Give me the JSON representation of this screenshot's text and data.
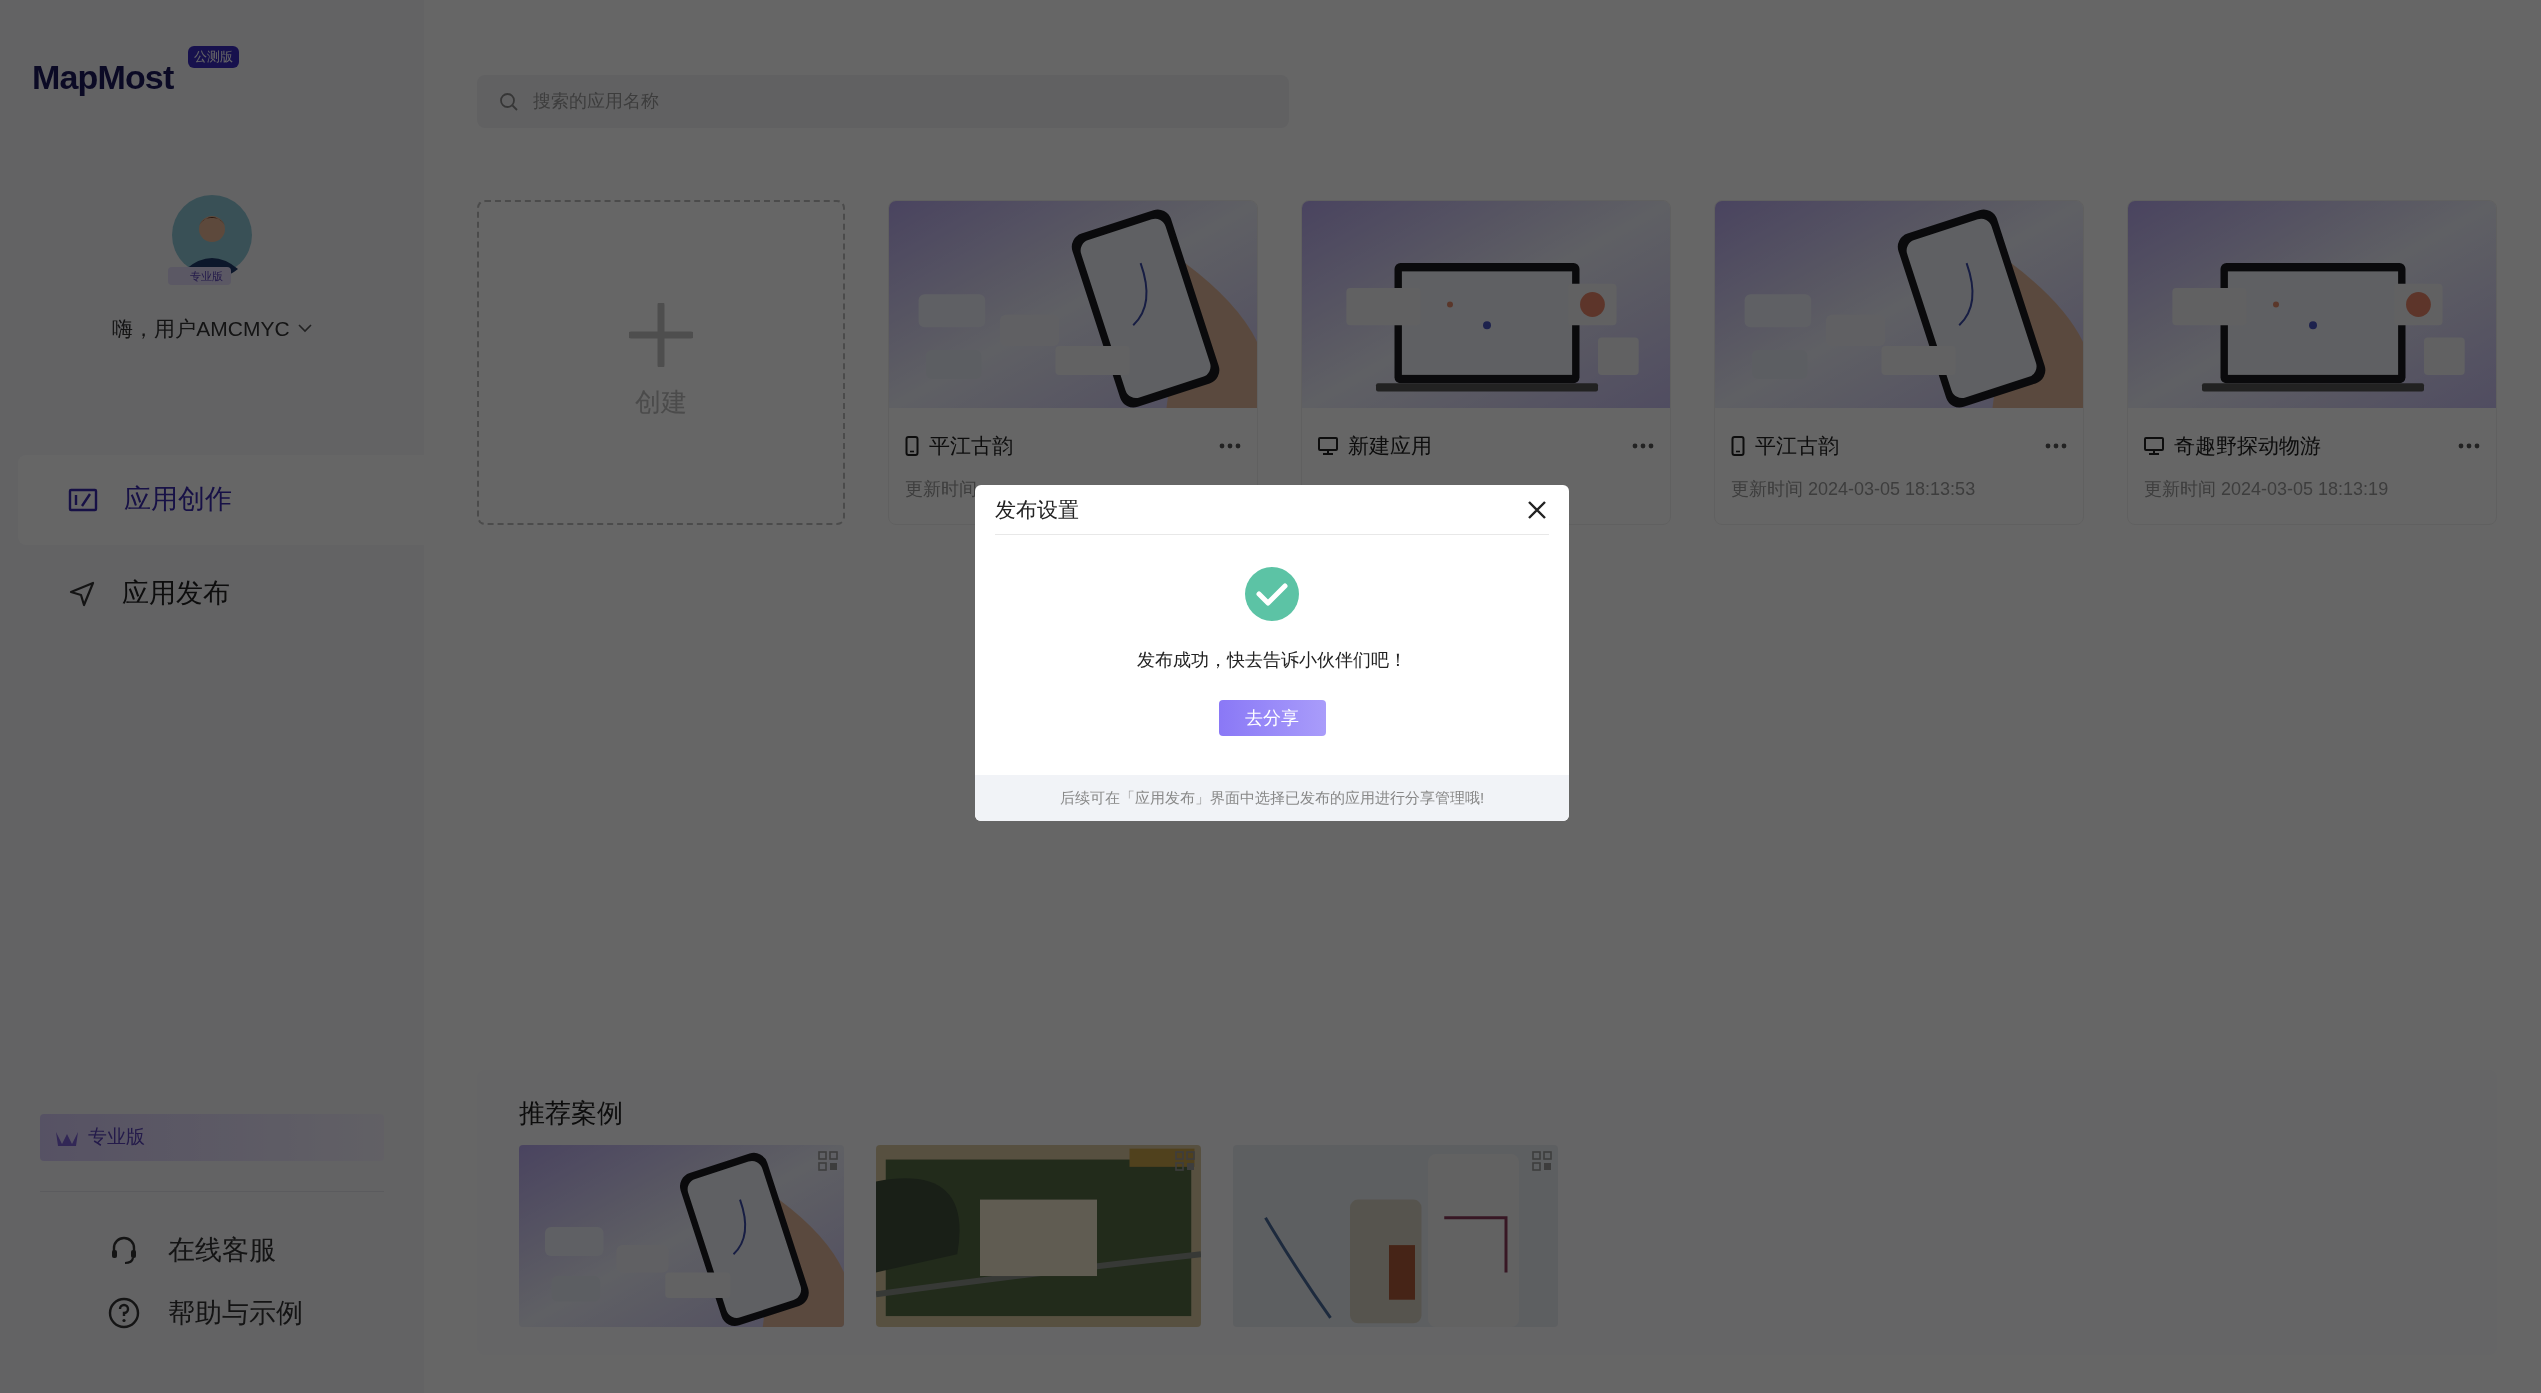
{
  "brand": {
    "name": "MapMost",
    "badge": "公测版"
  },
  "user": {
    "plan_badge": "专业版",
    "greeting": "嗨，用户AMCMYC"
  },
  "nav": [
    {
      "label": "应用创作",
      "kind": "create",
      "selected": true
    },
    {
      "label": "应用发布",
      "kind": "publish",
      "selected": false
    }
  ],
  "plan_banner": "专业版",
  "help_links": [
    {
      "label": "在线客服",
      "kind": "headset"
    },
    {
      "label": "帮助与示例",
      "kind": "help"
    }
  ],
  "search": {
    "placeholder": "搜索的应用名称"
  },
  "create_card": {
    "label": "创建"
  },
  "apps": [
    {
      "name": "平江古韵",
      "kind": "mobile",
      "updated": "更新时间"
    },
    {
      "name": "新建应用",
      "kind": "pc"
    },
    {
      "name": "平江古韵",
      "kind": "mobile",
      "updated": "更新时间 2024-03-05 18:13:53"
    },
    {
      "name": "奇趣野探动物游",
      "kind": "pc",
      "updated": "更新时间 2024-03-05 18:13:19"
    }
  ],
  "showcase": {
    "title": "推荐案例"
  },
  "dialog": {
    "title": "发布设置",
    "message": "发布成功，快去告诉小伙伴们吧！",
    "button": "去分享",
    "note": "后续可在「应用发布」界面中选择已发布的应用进行分享管理哦!"
  }
}
